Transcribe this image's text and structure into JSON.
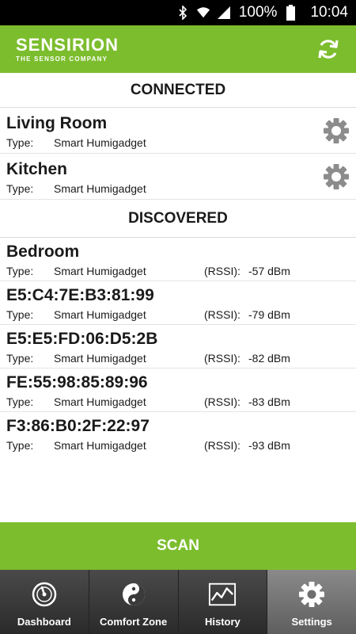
{
  "status_bar": {
    "battery_percent": "100%",
    "time": "10:04"
  },
  "header": {
    "brand_name": "SENSIRION",
    "brand_tagline": "THE SENSOR COMPANY",
    "accent_color": "#7cbd2e"
  },
  "connected": {
    "title": "CONNECTED",
    "devices": [
      {
        "name": "Living Room",
        "type_label": "Type:",
        "type": "Smart Humigadget"
      },
      {
        "name": "Kitchen",
        "type_label": "Type:",
        "type": "Smart Humigadget"
      }
    ]
  },
  "discovered": {
    "title": "DISCOVERED",
    "devices": [
      {
        "name": "Bedroom",
        "type_label": "Type:",
        "type": "Smart Humigadget",
        "rssi_label": "(RSSI):",
        "rssi": "-57 dBm"
      },
      {
        "name": "E5:C4:7E:B3:81:99",
        "type_label": "Type:",
        "type": "Smart Humigadget",
        "rssi_label": "(RSSI):",
        "rssi": "-79 dBm"
      },
      {
        "name": "E5:E5:FD:06:D5:2B",
        "type_label": "Type:",
        "type": "Smart Humigadget",
        "rssi_label": "(RSSI):",
        "rssi": "-82 dBm"
      },
      {
        "name": "FE:55:98:85:89:96",
        "type_label": "Type:",
        "type": "Smart Humigadget",
        "rssi_label": "(RSSI):",
        "rssi": "-83 dBm"
      },
      {
        "name": "F3:86:B0:2F:22:97",
        "type_label": "Type:",
        "type": "Smart Humigadget",
        "rssi_label": "(RSSI):",
        "rssi": "-93 dBm"
      }
    ]
  },
  "scan_button": {
    "label": "SCAN"
  },
  "bottom_nav": {
    "items": [
      {
        "label": "Dashboard",
        "icon": "dashboard-gauge-icon"
      },
      {
        "label": "Comfort Zone",
        "icon": "comfort-zone-yin-yang-icon"
      },
      {
        "label": "History",
        "icon": "history-chart-icon"
      },
      {
        "label": "Settings",
        "icon": "settings-gear-icon",
        "active": true
      }
    ]
  }
}
